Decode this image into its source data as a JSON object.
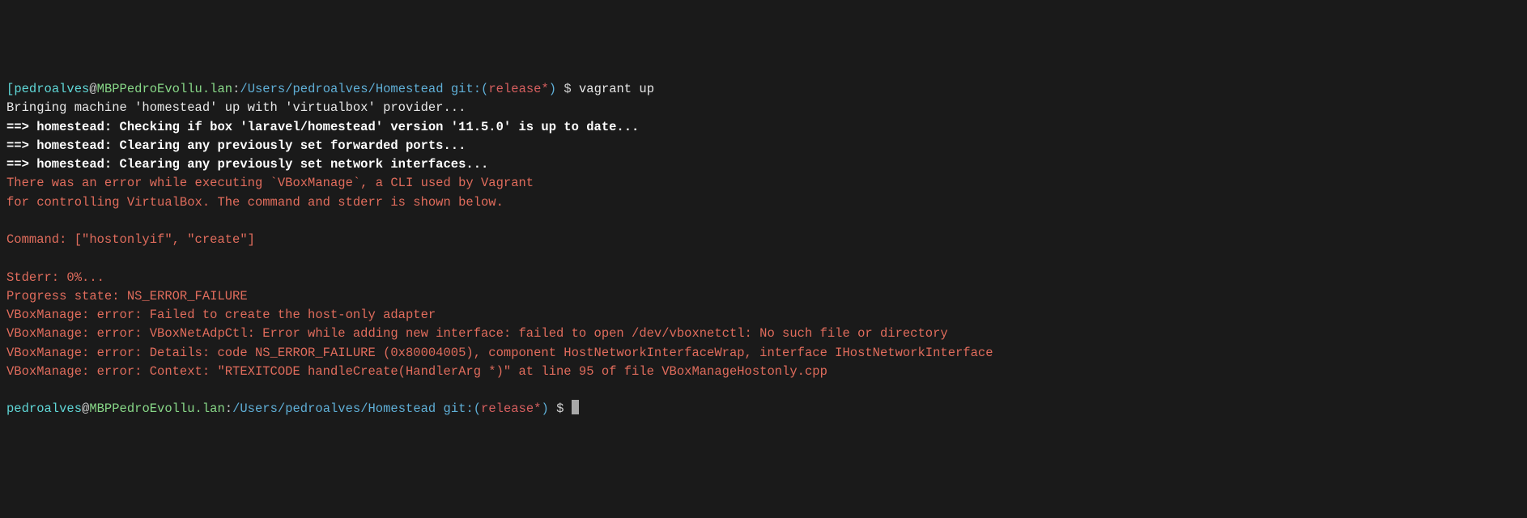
{
  "prompt1": {
    "bracket_open": "[",
    "user": "pedroalves",
    "at": "@",
    "host": "MBPPedroEvollu.lan",
    "colon": ":",
    "path": "/Users/pedroalves/Homestead",
    "git_label": " git:(",
    "branch": "release*",
    "git_close": ")",
    "dollar": " $ ",
    "command": "vagrant up"
  },
  "output": {
    "line1": "Bringing machine 'homestead' up with 'virtualbox' provider...",
    "line2": "==> homestead: Checking if box 'laravel/homestead' version '11.5.0' is up to date...",
    "line3": "==> homestead: Clearing any previously set forwarded ports...",
    "line4": "==> homestead: Clearing any previously set network interfaces...",
    "err1": "There was an error while executing `VBoxManage`, a CLI used by Vagrant",
    "err2": "for controlling VirtualBox. The command and stderr is shown below.",
    "err3": "Command: [\"hostonlyif\", \"create\"]",
    "err4": "Stderr: 0%...",
    "err5": "Progress state: NS_ERROR_FAILURE",
    "err6": "VBoxManage: error: Failed to create the host-only adapter",
    "err7": "VBoxManage: error: VBoxNetAdpCtl: Error while adding new interface: failed to open /dev/vboxnetctl: No such file or directory",
    "err8": "VBoxManage: error: Details: code NS_ERROR_FAILURE (0x80004005), component HostNetworkInterfaceWrap, interface IHostNetworkInterface",
    "err9": "VBoxManage: error: Context: \"RTEXITCODE handleCreate(HandlerArg *)\" at line 95 of file VBoxManageHostonly.cpp"
  },
  "prompt2": {
    "user": "pedroalves",
    "at": "@",
    "host": "MBPPedroEvollu.lan",
    "colon": ":",
    "path": "/Users/pedroalves/Homestead",
    "git_label": " git:(",
    "branch": "release*",
    "git_close": ")",
    "dollar": " $ "
  }
}
